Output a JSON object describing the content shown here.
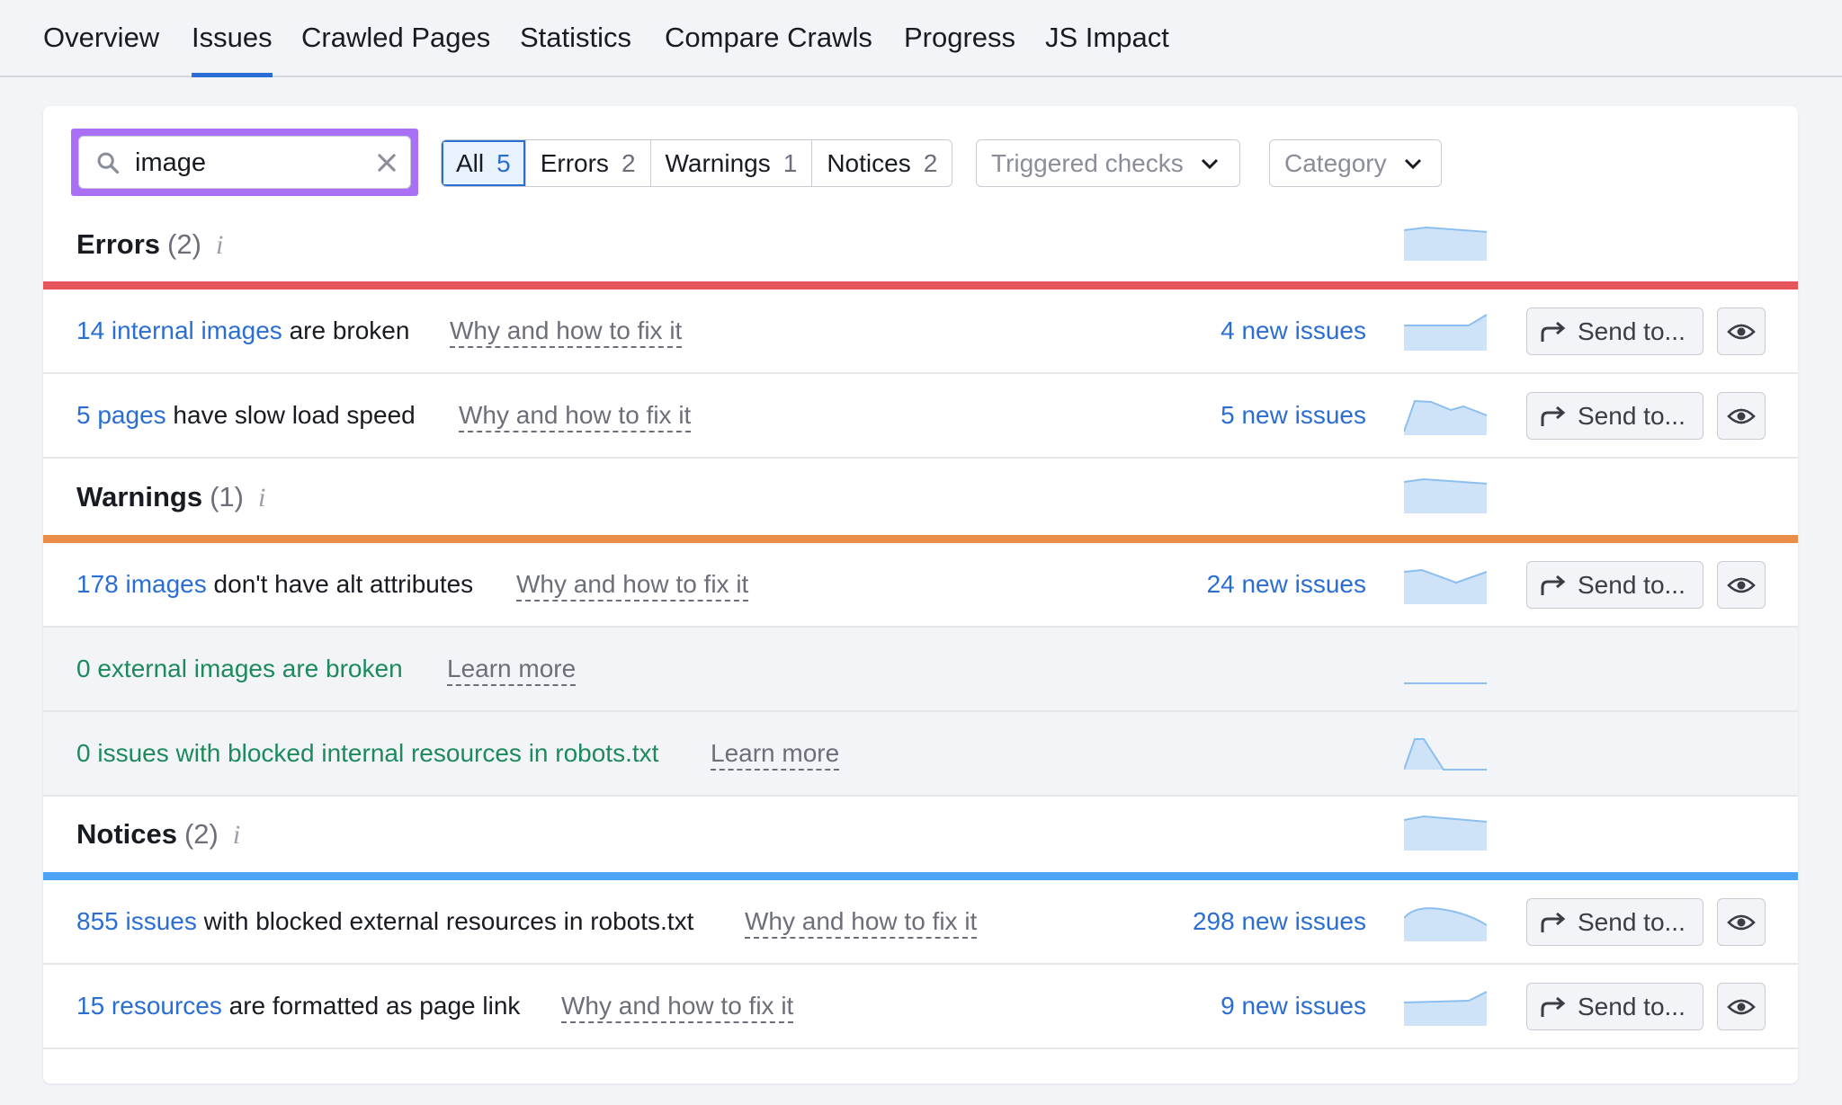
{
  "tabs": [
    {
      "label": "Overview"
    },
    {
      "label": "Issues"
    },
    {
      "label": "Crawled Pages"
    },
    {
      "label": "Statistics"
    },
    {
      "label": "Compare Crawls"
    },
    {
      "label": "Progress"
    },
    {
      "label": "JS Impact"
    }
  ],
  "active_tab": "Issues",
  "search": {
    "value": "image"
  },
  "filters": [
    {
      "label": "All",
      "count": "5"
    },
    {
      "label": "Errors",
      "count": "2"
    },
    {
      "label": "Warnings",
      "count": "1"
    },
    {
      "label": "Notices",
      "count": "2"
    }
  ],
  "active_filter": "All",
  "dropdowns": {
    "triggered": "Triggered checks",
    "category": "Category"
  },
  "sections": {
    "errors": {
      "name": "Errors",
      "count": "(2)",
      "info": "i",
      "color": "#e5535b"
    },
    "warnings": {
      "name": "Warnings",
      "count": "(1)",
      "info": "i",
      "color": "#e98e49"
    },
    "notices": {
      "name": "Notices",
      "count": "(2)",
      "info": "i",
      "color": "#4da3f5"
    }
  },
  "rows": [
    {
      "link": "14 internal images",
      "rest": " are broken",
      "why": "Why and how to fix it",
      "new": "4 new issues",
      "send": "Send to..."
    },
    {
      "link": "5 pages",
      "rest": " have slow load speed",
      "why": "Why and how to fix it",
      "new": "5 new issues",
      "send": "Send to..."
    },
    {
      "link": "178 images",
      "rest": " don't have alt attributes",
      "why": "Why and how to fix it",
      "new": "24 new issues",
      "send": "Send to..."
    },
    {
      "text": "0 external images are broken",
      "why": "Learn more"
    },
    {
      "text": "0 issues with blocked internal resources in robots.txt",
      "why": "Learn more"
    },
    {
      "link": "855 issues",
      "rest": " with blocked external resources in robots.txt",
      "why": "Why and how to fix it",
      "new": "298 new issues",
      "send": "Send to..."
    },
    {
      "link": "15 resources",
      "rest": " are formatted as page link",
      "why": "Why and how to fix it",
      "new": "9 new issues",
      "send": "Send to..."
    }
  ],
  "colors": {
    "accent": "#2a6ed4",
    "highlight": "#a970f5",
    "zero_text": "#1d8a5d",
    "sparkline_fill": "#cfe3f8",
    "sparkline_line": "#8cbff0"
  }
}
